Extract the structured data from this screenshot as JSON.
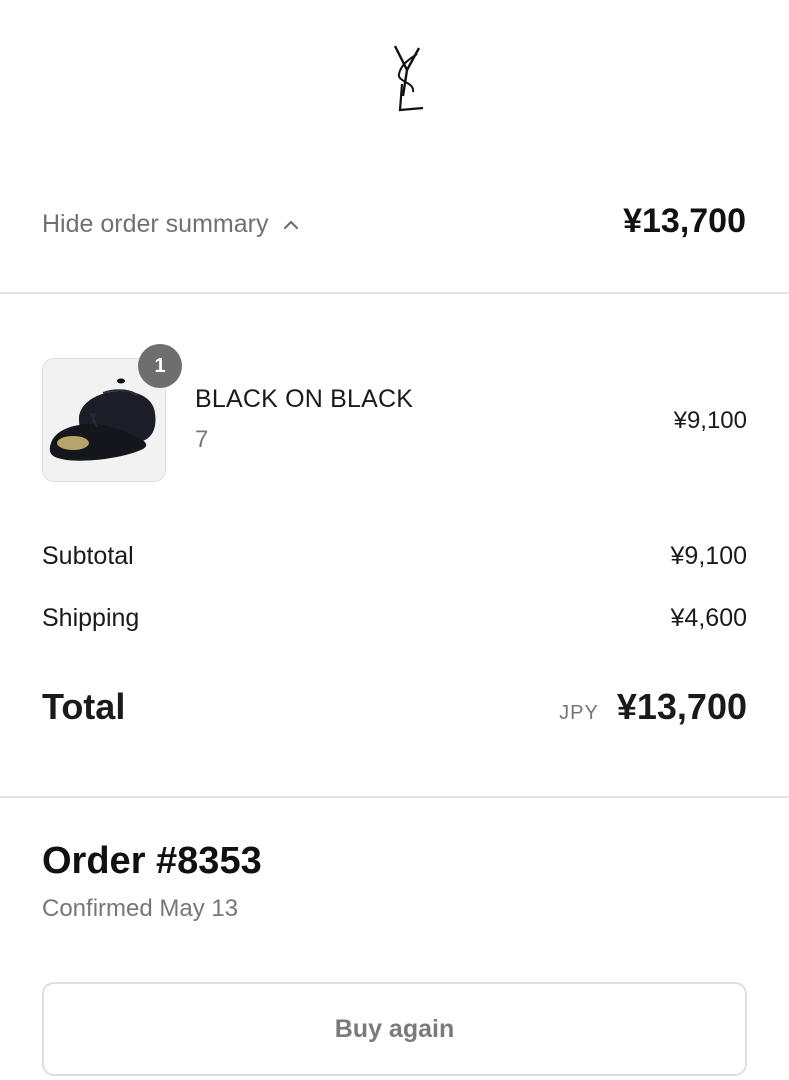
{
  "header": {
    "logo": "YSL"
  },
  "summary": {
    "toggle_label": "Hide order summary",
    "total": "¥13,700"
  },
  "line_items": [
    {
      "name": "BLACK ON BLACK",
      "variant": "7",
      "price": "¥9,100",
      "quantity": "1"
    }
  ],
  "totals": {
    "subtotal_label": "Subtotal",
    "subtotal_value": "¥9,100",
    "shipping_label": "Shipping",
    "shipping_value": "¥4,600",
    "total_label": "Total",
    "currency": "JPY",
    "total_value": "¥13,700"
  },
  "order": {
    "title": "Order #8353",
    "status": "Confirmed May 13",
    "buy_again_label": "Buy again"
  },
  "colors": {
    "divider": "#e3e3e3",
    "muted_text": "#777777",
    "badge": "#6e6e6e"
  }
}
